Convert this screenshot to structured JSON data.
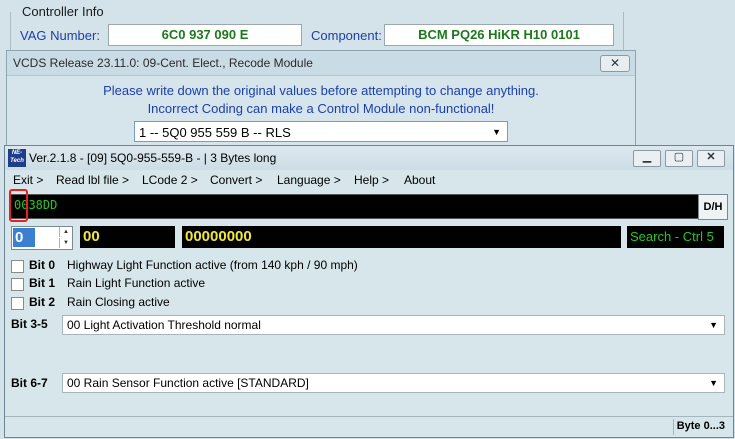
{
  "controller_info": {
    "title": "Controller Info",
    "vag_label": "VAG Number:",
    "vag_value": "6C0 937 090 E",
    "component_label": "Component:",
    "component_value": "BCM PQ26 HiKR H10 0101"
  },
  "recode_window": {
    "title": "VCDS Release 23.11.0: 09-Cent. Elect.,  Recode Module",
    "close_label": "✕",
    "warning_line1": "Please write down the original values before attempting to change anything.",
    "warning_line2": "Incorrect Coding can make a Control Module non-functional!",
    "module_selected": "1 -- 5Q0 955 559 B -- RLS"
  },
  "main_window": {
    "logo_text": "NE-Tech",
    "title": "Ver.2.1.8 - [09] 5Q0-955-559-B - | 3 Bytes long",
    "menu": [
      "Exit >",
      "Read lbl file >",
      "LCode 2 >",
      "Convert >",
      "Language >",
      "Help >",
      "About"
    ],
    "code_value": "0038DD",
    "dh_label": "D/H",
    "byte_index": "0",
    "hex_value": "00",
    "binary_value": "00000000",
    "search_label": "Search - Ctrl 5",
    "bits": [
      {
        "label": "Bit 0",
        "desc": "Highway Light Function active (from 140 kph / 90 mph)"
      },
      {
        "label": "Bit 1",
        "desc": "Rain Light Function active"
      },
      {
        "label": "Bit 2",
        "desc": "Rain Closing active"
      }
    ],
    "bit35_label": "Bit 3-5",
    "bit35_value": "00 Light Activation Threshold normal",
    "bit67_label": "Bit 6-7",
    "bit67_value": "00 Rain Sensor Function active [STANDARD]",
    "status_text": "Byte 0...3"
  },
  "colors": {
    "accent_blue": "#1c3fa8",
    "value_green": "#1c7a1c",
    "terminal_green": "#28c628",
    "terminal_yellow": "#f0e63c"
  }
}
